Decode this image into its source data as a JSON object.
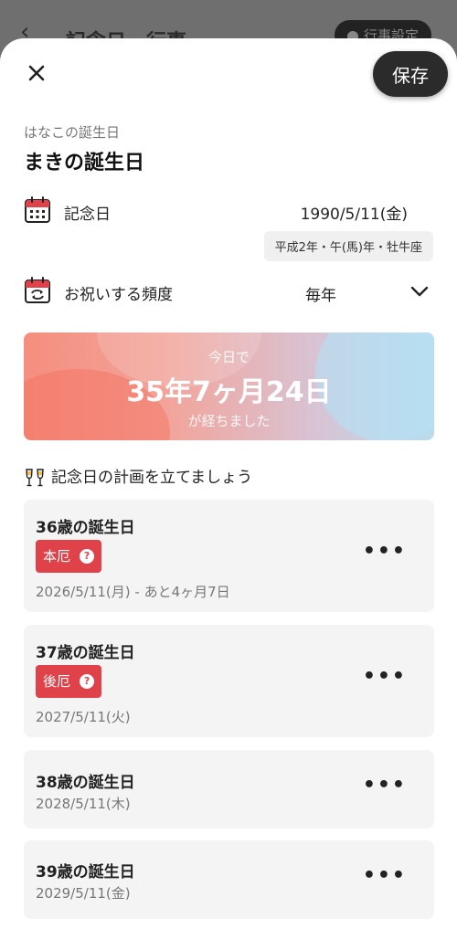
{
  "background": {
    "title": "記念日・行事",
    "pill_label": "行事設定"
  },
  "header": {
    "save_label": "保存"
  },
  "person": {
    "subtitle": "はなこの誕生日",
    "title": "まきの誕生日"
  },
  "anniversary": {
    "label": "記念日",
    "date": "1990/5/11(金)",
    "era": "平成2年・午(馬)年・牡牛座"
  },
  "frequency": {
    "label": "お祝いする頻度",
    "value": "毎年"
  },
  "banner": {
    "top": "今日で",
    "main": "35年7ヶ月24日",
    "bottom": "が経ちました"
  },
  "plan": {
    "heading": "記念日の計画を立てましょう"
  },
  "cards": [
    {
      "title": "36歳の誕生日",
      "badge": "本厄",
      "date": "2026/5/11(月) - あと4ヶ月7日"
    },
    {
      "title": "37歳の誕生日",
      "badge": "後厄",
      "date": "2027/5/11(火)"
    },
    {
      "title": "38歳の誕生日",
      "date": "2028/5/11(木)"
    },
    {
      "title": "39歳の誕生日",
      "date": "2029/5/11(金)"
    }
  ],
  "colors": {
    "badge": "#e0424a",
    "calendar_red": "#e0424a",
    "save_button": "#2b2b2b"
  }
}
